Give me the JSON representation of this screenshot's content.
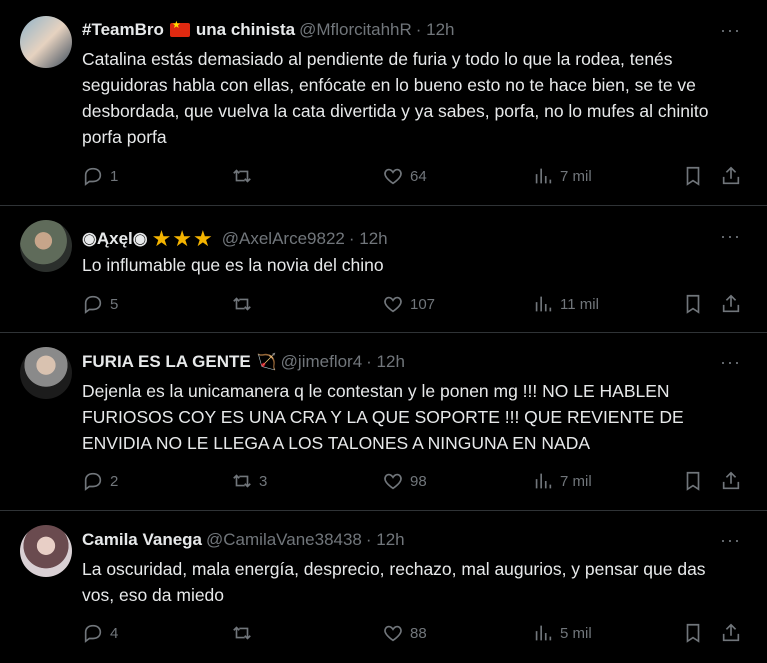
{
  "tweets": [
    {
      "name": "#TeamBro",
      "name_suffix": "una chinista",
      "handle": "@MflorcitahhR",
      "time": "· 12h",
      "text": "Catalina estás demasiado al pendiente de furia y todo lo que la rodea, tenés seguidoras habla con ellas, enfócate en lo bueno esto no te hace bien, se te ve desbordada, que vuelva la cata divertida y ya sabes, porfa, no lo mufes al chinito porfa porfa",
      "replies": "1",
      "retweets": "",
      "likes": "64",
      "views": "7 mil"
    },
    {
      "name": "◉Ąxęl◉",
      "handle": "@AxelArce9822",
      "time": "· 12h",
      "text": "Lo influmable que es la novia del chino",
      "replies": "5",
      "retweets": "",
      "likes": "107",
      "views": "11 mil"
    },
    {
      "name": "FURIA ES LA GENTE",
      "handle": "@jimeflor4",
      "time": "· 12h",
      "text": "Dejenla es la unicamanera q le contestan y le ponen mg !!! NO LE HABLEN FURIOSOS COY ES UNA CRA Y LA QUE SOPORTE !!! QUE REVIENTE DE ENVIDIA NO LE LLEGA A LOS TALONES A NINGUNA EN NADA",
      "replies": "2",
      "retweets": "3",
      "likes": "98",
      "views": "7 mil"
    },
    {
      "name": "Camila Vanega",
      "handle": "@CamilaVane38438",
      "time": "· 12h",
      "text": "La oscuridad, mala energía, desprecio, rechazo, mal augurios, y pensar que das vos, eso da miedo",
      "replies": "4",
      "retweets": "",
      "likes": "88",
      "views": "5 mil"
    }
  ],
  "more_label": "···"
}
